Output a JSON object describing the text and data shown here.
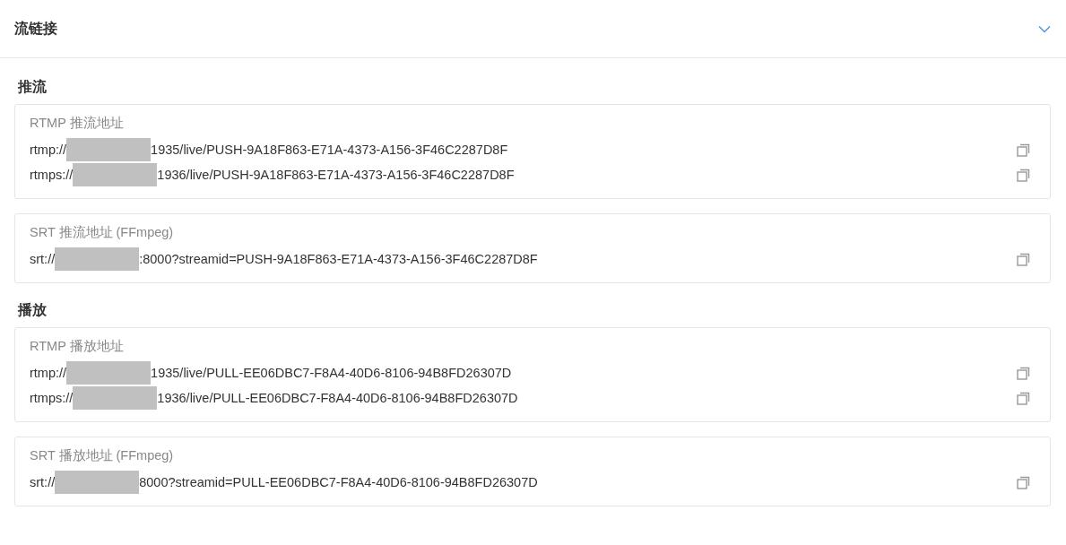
{
  "panel": {
    "title": "流链接",
    "expanded": true
  },
  "sections": [
    {
      "heading": "推流",
      "cards": [
        {
          "label": "RTMP 推流地址",
          "urls": [
            {
              "prefix": "rtmp://",
              "redacted": true,
              "suffix": "1935/live/PUSH-9A18F863-E71A-4373-A156-3F46C2287D8F"
            },
            {
              "prefix": "rtmps://",
              "redacted": true,
              "suffix": "1936/live/PUSH-9A18F863-E71A-4373-A156-3F46C2287D8F"
            }
          ]
        },
        {
          "label": "SRT 推流地址 (FFmpeg)",
          "urls": [
            {
              "prefix": "srt://",
              "redacted": true,
              "suffix": ":8000?streamid=PUSH-9A18F863-E71A-4373-A156-3F46C2287D8F"
            }
          ]
        }
      ]
    },
    {
      "heading": "播放",
      "cards": [
        {
          "label": "RTMP 播放地址",
          "urls": [
            {
              "prefix": "rtmp://",
              "redacted": true,
              "suffix": "1935/live/PULL-EE06DBC7-F8A4-40D6-8106-94B8FD26307D"
            },
            {
              "prefix": "rtmps://",
              "redacted": true,
              "suffix": "1936/live/PULL-EE06DBC7-F8A4-40D6-8106-94B8FD26307D"
            }
          ]
        },
        {
          "label": "SRT 播放地址 (FFmpeg)",
          "urls": [
            {
              "prefix": "srt://",
              "redacted": true,
              "suffix": "8000?streamid=PULL-EE06DBC7-F8A4-40D6-8106-94B8FD26307D"
            }
          ]
        }
      ]
    }
  ]
}
